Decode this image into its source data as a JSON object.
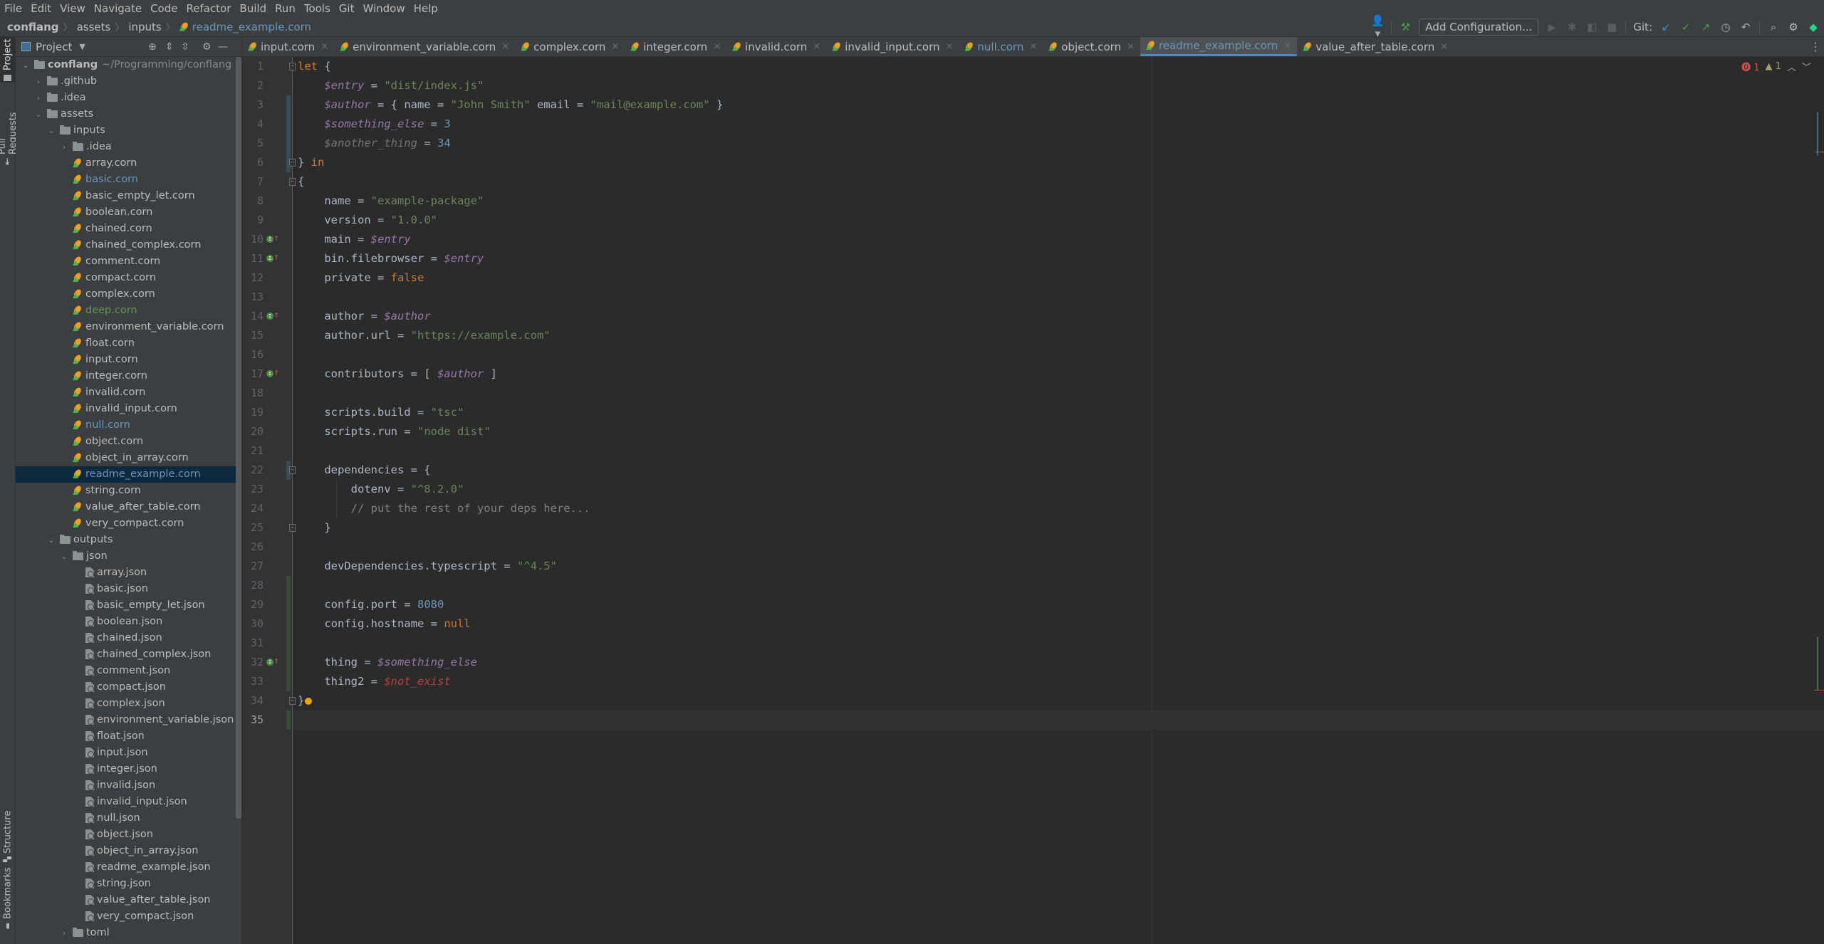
{
  "menu": [
    "File",
    "Edit",
    "View",
    "Navigate",
    "Code",
    "Refactor",
    "Build",
    "Run",
    "Tools",
    "Git",
    "Window",
    "Help"
  ],
  "breadcrumb": {
    "project": "conflang",
    "items": [
      "assets",
      "inputs"
    ],
    "file": "readme_example.corn"
  },
  "toolbar": {
    "add_configuration": "Add Configuration...",
    "git_label": "Git:",
    "icons": [
      "user-icon",
      "hammer-icon",
      "run-icon",
      "debug-icon",
      "coverage-icon",
      "stop-icon",
      "git-update-icon",
      "git-commit-icon",
      "git-push-icon",
      "history-icon",
      "rollback-icon",
      "search-icon",
      "settings-icon",
      "toolbox-icon"
    ]
  },
  "side_tabs": {
    "project": "Project",
    "pull_requests": "Pull Requests",
    "structure": "Structure",
    "bookmarks": "Bookmarks"
  },
  "project_panel": {
    "title": "Project",
    "tree": [
      {
        "depth": 0,
        "type": "root",
        "expanded": true,
        "label": "conflang",
        "hint": "~/Programming/conflang"
      },
      {
        "depth": 1,
        "type": "folder",
        "expanded": false,
        "label": ".github"
      },
      {
        "depth": 1,
        "type": "folder",
        "expanded": false,
        "label": ".idea"
      },
      {
        "depth": 1,
        "type": "folder",
        "expanded": true,
        "label": "assets"
      },
      {
        "depth": 2,
        "type": "folder",
        "expanded": true,
        "label": "inputs"
      },
      {
        "depth": 3,
        "type": "folder",
        "expanded": false,
        "label": ".idea"
      },
      {
        "depth": 3,
        "type": "corn",
        "label": "array.corn"
      },
      {
        "depth": 3,
        "type": "corn",
        "label": "basic.corn",
        "status": "modified"
      },
      {
        "depth": 3,
        "type": "corn",
        "label": "basic_empty_let.corn"
      },
      {
        "depth": 3,
        "type": "corn",
        "label": "boolean.corn"
      },
      {
        "depth": 3,
        "type": "corn",
        "label": "chained.corn"
      },
      {
        "depth": 3,
        "type": "corn",
        "label": "chained_complex.corn"
      },
      {
        "depth": 3,
        "type": "corn",
        "label": "comment.corn"
      },
      {
        "depth": 3,
        "type": "corn",
        "label": "compact.corn"
      },
      {
        "depth": 3,
        "type": "corn",
        "label": "complex.corn"
      },
      {
        "depth": 3,
        "type": "corn",
        "label": "deep.corn",
        "status": "added"
      },
      {
        "depth": 3,
        "type": "corn",
        "label": "environment_variable.corn"
      },
      {
        "depth": 3,
        "type": "corn",
        "label": "float.corn"
      },
      {
        "depth": 3,
        "type": "corn",
        "label": "input.corn"
      },
      {
        "depth": 3,
        "type": "corn",
        "label": "integer.corn"
      },
      {
        "depth": 3,
        "type": "corn",
        "label": "invalid.corn"
      },
      {
        "depth": 3,
        "type": "corn",
        "label": "invalid_input.corn"
      },
      {
        "depth": 3,
        "type": "corn",
        "label": "null.corn",
        "status": "modified"
      },
      {
        "depth": 3,
        "type": "corn",
        "label": "object.corn"
      },
      {
        "depth": 3,
        "type": "corn",
        "label": "object_in_array.corn"
      },
      {
        "depth": 3,
        "type": "corn",
        "label": "readme_example.corn",
        "status": "modified",
        "selected": true
      },
      {
        "depth": 3,
        "type": "corn",
        "label": "string.corn"
      },
      {
        "depth": 3,
        "type": "corn",
        "label": "value_after_table.corn"
      },
      {
        "depth": 3,
        "type": "corn",
        "label": "very_compact.corn"
      },
      {
        "depth": 2,
        "type": "folder",
        "expanded": true,
        "label": "outputs"
      },
      {
        "depth": 3,
        "type": "folder",
        "expanded": true,
        "label": "json"
      },
      {
        "depth": 4,
        "type": "json",
        "label": "array.json"
      },
      {
        "depth": 4,
        "type": "json",
        "label": "basic.json"
      },
      {
        "depth": 4,
        "type": "json",
        "label": "basic_empty_let.json"
      },
      {
        "depth": 4,
        "type": "json",
        "label": "boolean.json"
      },
      {
        "depth": 4,
        "type": "json",
        "label": "chained.json"
      },
      {
        "depth": 4,
        "type": "json",
        "label": "chained_complex.json"
      },
      {
        "depth": 4,
        "type": "json",
        "label": "comment.json"
      },
      {
        "depth": 4,
        "type": "json",
        "label": "compact.json"
      },
      {
        "depth": 4,
        "type": "json",
        "label": "complex.json"
      },
      {
        "depth": 4,
        "type": "json",
        "label": "environment_variable.json"
      },
      {
        "depth": 4,
        "type": "json",
        "label": "float.json"
      },
      {
        "depth": 4,
        "type": "json",
        "label": "input.json"
      },
      {
        "depth": 4,
        "type": "json",
        "label": "integer.json"
      },
      {
        "depth": 4,
        "type": "json",
        "label": "invalid.json"
      },
      {
        "depth": 4,
        "type": "json",
        "label": "invalid_input.json"
      },
      {
        "depth": 4,
        "type": "json",
        "label": "null.json"
      },
      {
        "depth": 4,
        "type": "json",
        "label": "object.json"
      },
      {
        "depth": 4,
        "type": "json",
        "label": "object_in_array.json"
      },
      {
        "depth": 4,
        "type": "json",
        "label": "readme_example.json"
      },
      {
        "depth": 4,
        "type": "json",
        "label": "string.json"
      },
      {
        "depth": 4,
        "type": "json",
        "label": "value_after_table.json"
      },
      {
        "depth": 4,
        "type": "json",
        "label": "very_compact.json"
      },
      {
        "depth": 3,
        "type": "folder",
        "expanded": false,
        "label": "toml"
      }
    ]
  },
  "tabs": [
    {
      "label": "input.corn"
    },
    {
      "label": "environment_variable.corn"
    },
    {
      "label": "complex.corn"
    },
    {
      "label": "integer.corn"
    },
    {
      "label": "invalid.corn"
    },
    {
      "label": "invalid_input.corn"
    },
    {
      "label": "null.corn",
      "status": "modified"
    },
    {
      "label": "object.corn"
    },
    {
      "label": "readme_example.corn",
      "active": true
    },
    {
      "label": "value_after_table.corn"
    }
  ],
  "inspections": {
    "errors": "1",
    "warnings": "1"
  },
  "editor": {
    "current_line": 35,
    "lines": [
      [
        [
          "kw",
          "let"
        ],
        [
          "p",
          " {"
        ]
      ],
      [
        [
          "p",
          "    "
        ],
        [
          "var",
          "$entry"
        ],
        [
          "p",
          " = "
        ],
        [
          "str",
          "\"dist/index.js\""
        ]
      ],
      [
        [
          "p",
          "    "
        ],
        [
          "var",
          "$author"
        ],
        [
          "p",
          " = { name = "
        ],
        [
          "str",
          "\"John Smith\""
        ],
        [
          "p",
          " email = "
        ],
        [
          "str",
          "\"mail@example.com\""
        ],
        [
          "p",
          " }"
        ]
      ],
      [
        [
          "p",
          "    "
        ],
        [
          "var",
          "$something_else"
        ],
        [
          "p",
          " = "
        ],
        [
          "num",
          "3"
        ]
      ],
      [
        [
          "p",
          "    "
        ],
        [
          "unused",
          "$another_thing"
        ],
        [
          "p",
          " = "
        ],
        [
          "num",
          "34"
        ]
      ],
      [
        [
          "p",
          "} "
        ],
        [
          "kw",
          "in"
        ]
      ],
      [
        [
          "p",
          "{"
        ]
      ],
      [
        [
          "p",
          "    name = "
        ],
        [
          "str",
          "\"example-package\""
        ]
      ],
      [
        [
          "p",
          "    version = "
        ],
        [
          "str",
          "\"1.0.0\""
        ]
      ],
      [
        [
          "p",
          "    main = "
        ],
        [
          "var",
          "$entry"
        ]
      ],
      [
        [
          "p",
          "    bin.filebrowser = "
        ],
        [
          "var",
          "$entry"
        ]
      ],
      [
        [
          "p",
          "    private = "
        ],
        [
          "kw",
          "false"
        ]
      ],
      [],
      [
        [
          "p",
          "    author = "
        ],
        [
          "var",
          "$author"
        ]
      ],
      [
        [
          "p",
          "    author.url = "
        ],
        [
          "str",
          "\"https://example.com\""
        ]
      ],
      [],
      [
        [
          "p",
          "    contributors = [ "
        ],
        [
          "var",
          "$author"
        ],
        [
          "p",
          " ]"
        ]
      ],
      [],
      [
        [
          "p",
          "    scripts.build = "
        ],
        [
          "str",
          "\"tsc\""
        ]
      ],
      [
        [
          "p",
          "    scripts.run = "
        ],
        [
          "str",
          "\"node dist\""
        ]
      ],
      [],
      [
        [
          "p",
          "    dependencies = {"
        ]
      ],
      [
        [
          "p",
          "        dotenv = "
        ],
        [
          "str",
          "\"^8.2.0\""
        ]
      ],
      [
        [
          "p",
          "        "
        ],
        [
          "cmt",
          "// put the rest of your deps here..."
        ]
      ],
      [
        [
          "p",
          "    }"
        ]
      ],
      [],
      [
        [
          "p",
          "    devDependencies.typescript = "
        ],
        [
          "str",
          "\"^4.5\""
        ]
      ],
      [],
      [
        [
          "p",
          "    config.port = "
        ],
        [
          "num",
          "8080"
        ]
      ],
      [
        [
          "p",
          "    config.hostname = "
        ],
        [
          "kw",
          "null"
        ]
      ],
      [],
      [
        [
          "p",
          "    thing = "
        ],
        [
          "var",
          "$something_else"
        ]
      ],
      [
        [
          "p",
          "    thing2 = "
        ],
        [
          "err",
          "$not_exist"
        ]
      ],
      [
        [
          "p",
          "}"
        ]
      ],
      []
    ],
    "gutter_marks": [
      10,
      11,
      14,
      17,
      32
    ]
  }
}
